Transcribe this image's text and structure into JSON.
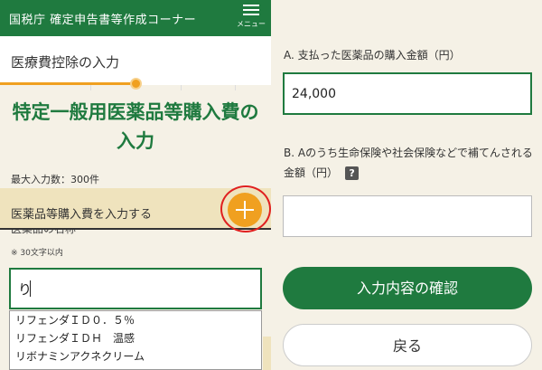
{
  "header": {
    "title": "国税庁 確定申告書等作成コーナー",
    "menu_label": "メニュー",
    "menu_icon": "hamburger-icon"
  },
  "subheader": {
    "title": "医療費控除の入力"
  },
  "progress": {
    "fraction": 0.5
  },
  "page_title_line1": "特定一般用医薬品等購入費の",
  "page_title_line2": "入力",
  "max_count": "最大入力数：300件",
  "add_bar": {
    "label": "医薬品等購入費を入力する",
    "icon": "plus-icon"
  },
  "medicine_name": {
    "label": "医薬品の名称",
    "hint": "※ 30文字以内",
    "value": "り"
  },
  "suggestions": [
    "リフェンダＩＤ０．５％",
    "リフェンダＩＤＨ　温感",
    "リボナミンアクネクリーム"
  ],
  "amount_paid": {
    "label": "A. 支払った医薬品の購入金額（円）",
    "value": "24,000"
  },
  "reimbursed": {
    "label": "B. Aのうち生命保険や社会保険などで補てんされる金額（円）",
    "help_icon": "question-icon",
    "help_text": "?",
    "value": ""
  },
  "buttons": {
    "confirm": "入力内容の確認",
    "back": "戻る"
  },
  "colors": {
    "brand_green": "#1f7a3f",
    "accent_orange": "#f0a020",
    "highlight_red": "#e02020",
    "background": "#f5f1e6",
    "add_bar_bg": "#efe3bd"
  }
}
